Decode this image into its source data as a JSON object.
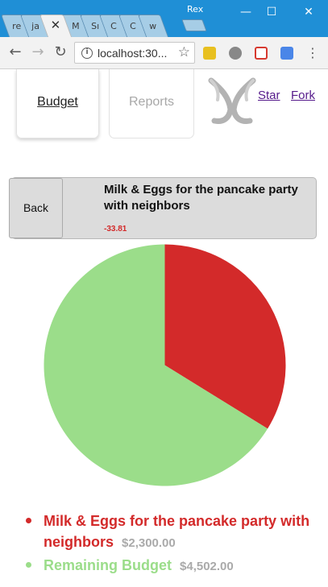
{
  "window": {
    "user": "Rex",
    "minimize_glyph": "—",
    "maximize_glyph": "☐",
    "close_glyph": "✕"
  },
  "tabs": [
    {
      "label": "re",
      "active": false
    },
    {
      "label": "ja",
      "active": false
    },
    {
      "label": "✕",
      "active": true
    },
    {
      "label": "M",
      "active": false
    },
    {
      "label": "Sı",
      "active": false
    },
    {
      "label": "C",
      "active": false
    },
    {
      "label": "C",
      "active": false
    },
    {
      "label": "w",
      "active": false
    }
  ],
  "toolbar": {
    "back_glyph": "←",
    "forward_glyph": "→",
    "reload_glyph": "↻",
    "info_glyph": "i",
    "url": "localhost:30...",
    "bookmark_glyph": "☆",
    "menu_glyph": "⋮",
    "extension_colors": [
      "#e8c020",
      "#888888",
      "#d63a30",
      "#4a86e8"
    ]
  },
  "nav": {
    "budget_label": "Budget",
    "reports_label": "Reports",
    "star_label": "Star",
    "fork_label": "Fork"
  },
  "detail": {
    "back_label": "Back",
    "title": "Milk & Eggs for the pancake party with neighbors",
    "amount": "-33.81"
  },
  "chart_data": {
    "type": "pie",
    "slices": [
      {
        "name": "Milk & Eggs for the pancake party with neighbors",
        "value": 2300.0,
        "color": "#d32a2a"
      },
      {
        "name": "Remaining Budget",
        "value": 4502.0,
        "color": "#9bdd8a"
      }
    ]
  },
  "legend": [
    {
      "label": "Milk & Eggs for the pancake party with neighbors",
      "amount": "$2,300.00"
    },
    {
      "label": "Remaining Budget",
      "amount": "$4,502.00"
    }
  ]
}
